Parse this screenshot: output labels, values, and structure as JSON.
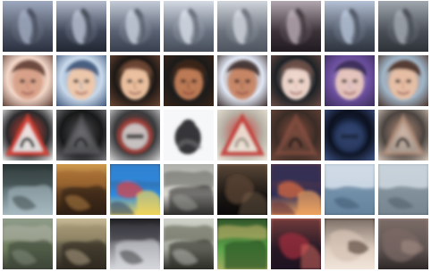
{
  "image": {
    "description_kind": "grid-of-generated-thumbnails",
    "rows": [
      {
        "category": "handwritten-digit-blurs",
        "tiles": [
          {
            "palette": [
              "#4e5666",
              "#7f889b",
              "#2c3140",
              "#9ea8be"
            ],
            "motif": "digit-blur"
          },
          {
            "palette": [
              "#3e4556",
              "#8b93a9",
              "#222833",
              "#b3bbcc"
            ],
            "motif": "digit-blur"
          },
          {
            "palette": [
              "#5a6273",
              "#a0a8b7",
              "#383f4d",
              "#c5ccd8"
            ],
            "motif": "digit-blur"
          },
          {
            "palette": [
              "#6a7281",
              "#b1b8c3",
              "#464d59",
              "#d5dbe4"
            ],
            "motif": "digit-blur"
          },
          {
            "palette": [
              "#6d737d",
              "#a1a7b0",
              "#4e5560",
              "#d1d5dc"
            ],
            "motif": "digit-blur"
          },
          {
            "palette": [
              "#3b3238",
              "#82727c",
              "#211b20",
              "#b3a7b0"
            ],
            "motif": "digit-blur"
          },
          {
            "palette": [
              "#505967",
              "#8893a6",
              "#2f3540",
              "#b5c1d5"
            ],
            "motif": "digit-blur"
          },
          {
            "palette": [
              "#4a4f57",
              "#7c828a",
              "#2e3238",
              "#a0a7af"
            ],
            "motif": "digit-blur"
          }
        ]
      },
      {
        "category": "faces",
        "tiles": [
          {
            "palette": [
              "#f1d6c8",
              "#b97a5d",
              "#5f3e34",
              "#d9a189"
            ],
            "motif": "face"
          },
          {
            "palette": [
              "#c7d8ea",
              "#7d9bc1",
              "#3e5478",
              "#f0c8aa"
            ],
            "motif": "face"
          },
          {
            "palette": [
              "#1d1916",
              "#a86d45",
              "#6f4633",
              "#f0c5a3"
            ],
            "motif": "face"
          },
          {
            "palette": [
              "#1c1b1a",
              "#6f4630",
              "#3a2418",
              "#c27d57"
            ],
            "motif": "face"
          },
          {
            "palette": [
              "#dfe6f3",
              "#8c5a45",
              "#3c2d2c",
              "#c88766"
            ],
            "motif": "face"
          },
          {
            "palette": [
              "#1e2226",
              "#d5b0a2",
              "#6c4d45",
              "#f1d8cd"
            ],
            "motif": "face"
          },
          {
            "palette": [
              "#6a4e9d",
              "#b9a4d4",
              "#382a55",
              "#e8c7bc"
            ],
            "motif": "face"
          },
          {
            "palette": [
              "#9eb4c7",
              "#c78d6d",
              "#4a3128",
              "#e8c0a5"
            ],
            "motif": "face"
          }
        ]
      },
      {
        "category": "traffic-signs",
        "tiles": [
          {
            "palette": [
              "#2b2b2d",
              "#d33d30",
              "#f1f1f1",
              "#1b1b1b"
            ],
            "motif": "sign-triangle"
          },
          {
            "palette": [
              "#171818",
              "#4f4f52",
              "#7c7d82",
              "#212224"
            ],
            "motif": "sign-triangle-dark"
          },
          {
            "palette": [
              "#3a3b3d",
              "#9d3b32",
              "#d7d7d7",
              "#1a1b1d"
            ],
            "motif": "sign-circle"
          },
          {
            "palette": [
              "#f6f7f8",
              "#2c2c2e",
              "#7c7b80",
              "#0f1012"
            ],
            "motif": "sign-dark-blob"
          },
          {
            "palette": [
              "#b8b1a6",
              "#c43c36",
              "#efe8dc",
              "#6c6358"
            ],
            "motif": "sign-triangle-light"
          },
          {
            "palette": [
              "#3a2c26",
              "#8b5040",
              "#6b463b",
              "#211b18"
            ],
            "motif": "sign-triangle-dim"
          },
          {
            "palette": [
              "#0d1220",
              "#1f2f53",
              "#40568a",
              "#090c14"
            ],
            "motif": "sign-circle-dark"
          },
          {
            "palette": [
              "#4b4440",
              "#b68f7a",
              "#d5c6ba",
              "#2c2522"
            ],
            "motif": "sign-triangle-blur"
          }
        ]
      },
      {
        "category": "blurred-scenes",
        "tiles": [
          {
            "palette": [
              "#6c7f84",
              "#3d4a4a",
              "#a7b9c0",
              "#263030"
            ],
            "motif": "scene"
          },
          {
            "palette": [
              "#5f3e22",
              "#a4652e",
              "#2b1c12",
              "#d19a4d"
            ],
            "motif": "scene"
          },
          {
            "palette": [
              "#2d8ae0",
              "#d9434a",
              "#f0d45b",
              "#3a4f6e"
            ],
            "motif": "scene-colorful"
          },
          {
            "palette": [
              "#d9d7d0",
              "#6b6a66",
              "#2d2d2c",
              "#aeb0a9"
            ],
            "motif": "scene"
          },
          {
            "palette": [
              "#2a231f",
              "#5b4434",
              "#0f0d0c",
              "#8b6f56"
            ],
            "motif": "scene-dark"
          },
          {
            "palette": [
              "#2f2e56",
              "#d56842",
              "#f0a45f",
              "#6b3c3d"
            ],
            "motif": "scene-colorful"
          },
          {
            "palette": [
              "#6f8da8",
              "#d8e2ec",
              "#3f5a72",
              "#a8b8c7"
            ],
            "motif": "scene-sky"
          },
          {
            "palette": [
              "#7f8e99",
              "#cfd8df",
              "#4f5d66",
              "#a3b0b8"
            ],
            "motif": "scene-sky"
          }
        ]
      },
      {
        "category": "blurred-scenes",
        "tiles": [
          {
            "palette": [
              "#6d7d5d",
              "#b2b3a5",
              "#3d4337",
              "#8f9c8a"
            ],
            "motif": "scene"
          },
          {
            "palette": [
              "#5c5642",
              "#9b8d6b",
              "#2f2a21",
              "#c9bb96"
            ],
            "motif": "scene"
          },
          {
            "palette": [
              "#8f8f96",
              "#3c3c42",
              "#d6d7dc",
              "#1c1c20"
            ],
            "motif": "scene"
          },
          {
            "palette": [
              "#a4a99d",
              "#5f6353",
              "#2c2e28",
              "#d0d3c9"
            ],
            "motif": "scene"
          },
          {
            "palette": [
              "#5aa44a",
              "#2f5a2a",
              "#c6b26b",
              "#1b2a17"
            ],
            "motif": "scene-green"
          },
          {
            "palette": [
              "#2e1f2b",
              "#a12e3d",
              "#1c1022",
              "#d56a5e"
            ],
            "motif": "scene-dark-red"
          },
          {
            "palette": [
              "#d6c3b4",
              "#8a6e5f",
              "#f1e4da",
              "#3e2e27"
            ],
            "motif": "scene-warm"
          },
          {
            "palette": [
              "#7a6a66",
              "#c2aaa0",
              "#2d2526",
              "#a78f88"
            ],
            "motif": "scene-warm"
          }
        ]
      }
    ]
  }
}
